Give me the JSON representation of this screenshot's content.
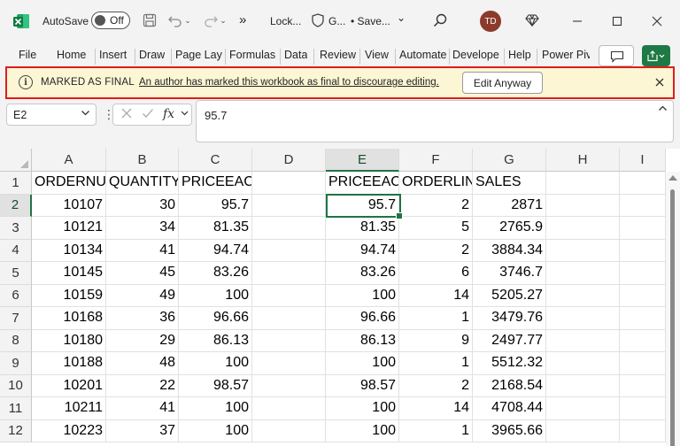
{
  "titlebar": {
    "autosave_label": "AutoSave",
    "autosave_state": "Off",
    "overflow": "»",
    "file_name": "Lock...",
    "sensitivity": "G...",
    "save_status": "• Save...",
    "save_chevron": "⌄",
    "user_initials": "TD",
    "accent_color": "#217346"
  },
  "ribbon": {
    "tabs": [
      "File",
      "Home",
      "Insert",
      "Draw",
      "Page Lay",
      "Formulas",
      "Data",
      "Review",
      "View",
      "Automate",
      "Develope",
      "Help",
      "Power Piv"
    ]
  },
  "message_bar": {
    "title": "MARKED AS FINAL",
    "text": "An author has marked this workbook as final to discourage editing.",
    "button": "Edit Anyway",
    "border_color": "#e01c1c"
  },
  "formula_bar": {
    "name_box": "E2",
    "formula_value": "95.7",
    "fx_label": "fx"
  },
  "sheet": {
    "columns": [
      "A",
      "B",
      "C",
      "D",
      "E",
      "F",
      "G",
      "H",
      "I"
    ],
    "rows": [
      [
        "ORDERNUMBER",
        "QUANTITYORDERED",
        "PRICEEACH",
        "",
        "PRICEEACH",
        "ORDERLINENUMBER",
        "SALES",
        "",
        ""
      ],
      [
        "10107",
        "30",
        "95.7",
        "",
        "95.7",
        "2",
        "2871",
        "",
        ""
      ],
      [
        "10121",
        "34",
        "81.35",
        "",
        "81.35",
        "5",
        "2765.9",
        "",
        ""
      ],
      [
        "10134",
        "41",
        "94.74",
        "",
        "94.74",
        "2",
        "3884.34",
        "",
        ""
      ],
      [
        "10145",
        "45",
        "83.26",
        "",
        "83.26",
        "6",
        "3746.7",
        "",
        ""
      ],
      [
        "10159",
        "49",
        "100",
        "",
        "100",
        "14",
        "5205.27",
        "",
        ""
      ],
      [
        "10168",
        "36",
        "96.66",
        "",
        "96.66",
        "1",
        "3479.76",
        "",
        ""
      ],
      [
        "10180",
        "29",
        "86.13",
        "",
        "86.13",
        "9",
        "2497.77",
        "",
        ""
      ],
      [
        "10188",
        "48",
        "100",
        "",
        "100",
        "1",
        "5512.32",
        "",
        ""
      ],
      [
        "10201",
        "22",
        "98.57",
        "",
        "98.57",
        "2",
        "2168.54",
        "",
        ""
      ],
      [
        "10211",
        "41",
        "100",
        "",
        "100",
        "14",
        "4708.44",
        "",
        ""
      ],
      [
        "10223",
        "37",
        "100",
        "",
        "100",
        "1",
        "3965.66",
        "",
        ""
      ]
    ],
    "row_numbers": [
      "1",
      "2",
      "3",
      "4",
      "5",
      "6",
      "7",
      "8",
      "9",
      "10",
      "11",
      "12"
    ],
    "selected_column": "E",
    "selected_row": "2"
  }
}
